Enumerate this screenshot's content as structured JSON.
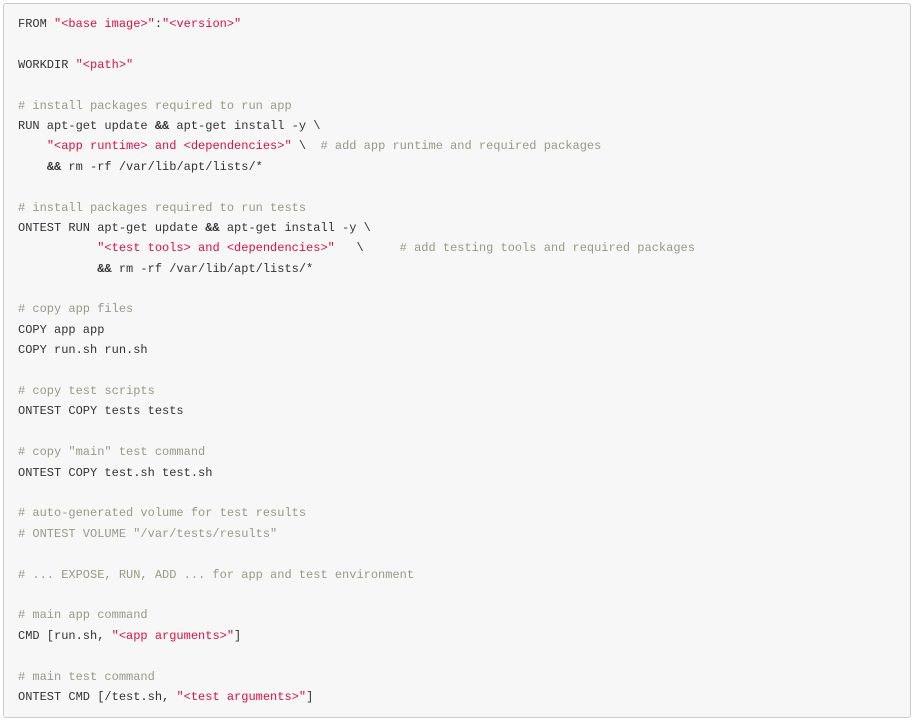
{
  "lines": [
    {
      "segments": [
        {
          "t": "text",
          "v": "FROM "
        },
        {
          "t": "string",
          "v": "\"<base image>\""
        },
        {
          "t": "text",
          "v": ":"
        },
        {
          "t": "string",
          "v": "\"<version>\""
        }
      ]
    },
    {
      "segments": []
    },
    {
      "segments": [
        {
          "t": "text",
          "v": "WORKDIR "
        },
        {
          "t": "string",
          "v": "\"<path>\""
        }
      ]
    },
    {
      "segments": []
    },
    {
      "segments": [
        {
          "t": "comment",
          "v": "# install packages required to run app"
        }
      ]
    },
    {
      "segments": [
        {
          "t": "text",
          "v": "RUN apt-get update "
        },
        {
          "t": "operator",
          "v": "&&"
        },
        {
          "t": "text",
          "v": " apt-get install -y \\"
        }
      ]
    },
    {
      "segments": [
        {
          "t": "text",
          "v": "    "
        },
        {
          "t": "string",
          "v": "\"<app runtime> and <dependencies>\""
        },
        {
          "t": "text",
          "v": " \\  "
        },
        {
          "t": "comment",
          "v": "# add app runtime and required packages"
        }
      ]
    },
    {
      "segments": [
        {
          "t": "text",
          "v": "    "
        },
        {
          "t": "operator",
          "v": "&&"
        },
        {
          "t": "text",
          "v": " rm -rf /var/lib/apt/lists/*"
        }
      ]
    },
    {
      "segments": []
    },
    {
      "segments": [
        {
          "t": "comment",
          "v": "# install packages required to run tests"
        }
      ]
    },
    {
      "segments": [
        {
          "t": "text",
          "v": "ONTEST RUN apt-get update "
        },
        {
          "t": "operator",
          "v": "&&"
        },
        {
          "t": "text",
          "v": " apt-get install -y \\"
        }
      ]
    },
    {
      "segments": [
        {
          "t": "text",
          "v": "           "
        },
        {
          "t": "string",
          "v": "\"<test tools> and <dependencies>\""
        },
        {
          "t": "text",
          "v": "   \\     "
        },
        {
          "t": "comment",
          "v": "# add testing tools and required packages"
        }
      ]
    },
    {
      "segments": [
        {
          "t": "text",
          "v": "           "
        },
        {
          "t": "operator",
          "v": "&&"
        },
        {
          "t": "text",
          "v": " rm -rf /var/lib/apt/lists/*"
        }
      ]
    },
    {
      "segments": []
    },
    {
      "segments": [
        {
          "t": "comment",
          "v": "# copy app files"
        }
      ]
    },
    {
      "segments": [
        {
          "t": "text",
          "v": "COPY app app"
        }
      ]
    },
    {
      "segments": [
        {
          "t": "text",
          "v": "COPY run.sh run.sh"
        }
      ]
    },
    {
      "segments": []
    },
    {
      "segments": [
        {
          "t": "comment",
          "v": "# copy test scripts"
        }
      ]
    },
    {
      "segments": [
        {
          "t": "text",
          "v": "ONTEST COPY tests tests"
        }
      ]
    },
    {
      "segments": []
    },
    {
      "segments": [
        {
          "t": "comment",
          "v": "# copy \"main\" test command"
        }
      ]
    },
    {
      "segments": [
        {
          "t": "text",
          "v": "ONTEST COPY test.sh test.sh"
        }
      ]
    },
    {
      "segments": []
    },
    {
      "segments": [
        {
          "t": "comment",
          "v": "# auto-generated volume for test results"
        }
      ]
    },
    {
      "segments": [
        {
          "t": "comment",
          "v": "# ONTEST VOLUME \"/var/tests/results\""
        }
      ]
    },
    {
      "segments": []
    },
    {
      "segments": [
        {
          "t": "comment",
          "v": "# ... EXPOSE, RUN, ADD ... for app and test environment"
        }
      ]
    },
    {
      "segments": []
    },
    {
      "segments": [
        {
          "t": "comment",
          "v": "# main app command"
        }
      ]
    },
    {
      "segments": [
        {
          "t": "text",
          "v": "CMD [run.sh, "
        },
        {
          "t": "string",
          "v": "\"<app arguments>\""
        },
        {
          "t": "text",
          "v": "]"
        }
      ]
    },
    {
      "segments": []
    },
    {
      "segments": [
        {
          "t": "comment",
          "v": "# main test command"
        }
      ]
    },
    {
      "segments": [
        {
          "t": "text",
          "v": "ONTEST CMD [/test.sh, "
        },
        {
          "t": "string",
          "v": "\"<test arguments>\""
        },
        {
          "t": "text",
          "v": "]"
        }
      ]
    }
  ]
}
